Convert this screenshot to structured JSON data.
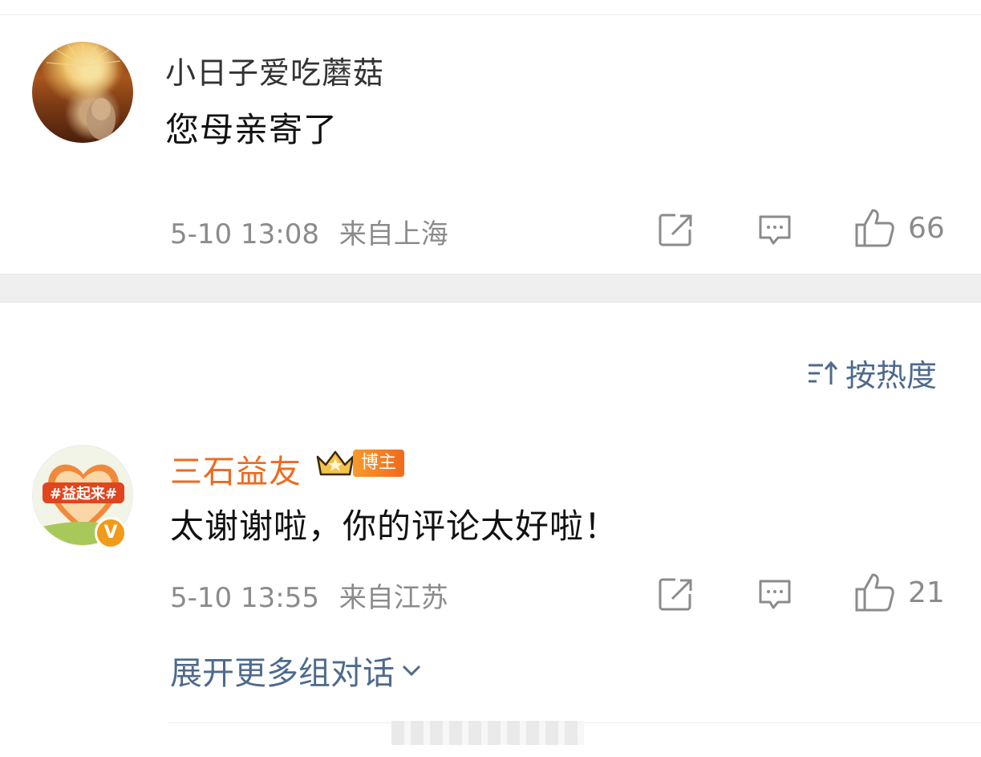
{
  "comments": [
    {
      "username": "小日子爱吃蘑菇",
      "content": "您母亲寄了",
      "time": "5-10 13:08",
      "location": "来自上海",
      "likes": "66"
    },
    {
      "username": "三石益友",
      "badge": "博主",
      "content": "太谢谢啦，你的评论太好啦！",
      "time": "5-10 13:55",
      "location": "来自江苏",
      "likes": "21",
      "avatar_text": "#益起来#",
      "verified_mark": "V"
    }
  ],
  "sort": {
    "label": "按热度"
  },
  "expand": {
    "label": "展开更多组对话"
  },
  "icons": {
    "share": "share-icon",
    "comment": "comment-icon",
    "like": "thumbs-up-icon",
    "sort": "sort-icon",
    "chevron": "chevron-down-icon",
    "crown": "crown-icon"
  },
  "colors": {
    "username_highlight": "#ee6a1e",
    "link": "#4e6a8c",
    "meta": "#8b8b8b"
  }
}
